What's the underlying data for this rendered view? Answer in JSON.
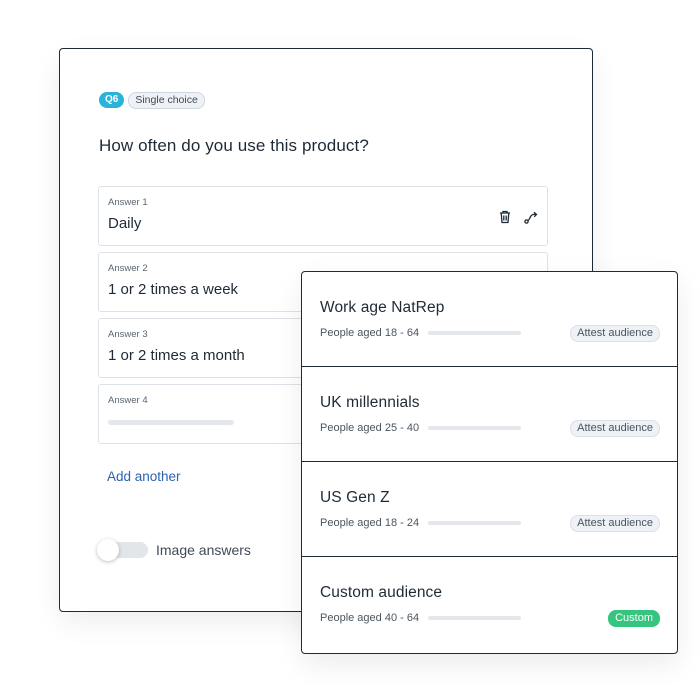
{
  "question": {
    "number_tag": "Q6",
    "type_tag": "Single choice",
    "title": "How often do you use this product?",
    "answers": [
      {
        "label": "Answer 1",
        "value": "Daily"
      },
      {
        "label": "Answer 2",
        "value": "1 or 2 times a week"
      },
      {
        "label": "Answer 3",
        "value": "1 or 2 times a month"
      },
      {
        "label": "Answer 4",
        "value": ""
      }
    ],
    "add_another": "Add another",
    "image_answers_label": "Image answers",
    "icons": {
      "delete": "trash-icon",
      "route": "route-icon"
    }
  },
  "audiences": [
    {
      "name": "Work age NatRep",
      "subtitle": "People aged 18 - 64",
      "badge": "Attest audience"
    },
    {
      "name": "UK millennials",
      "subtitle": "People aged 25 - 40",
      "badge": "Attest audience"
    },
    {
      "name": "US Gen Z",
      "subtitle": "People aged 18 - 24",
      "badge": "Attest audience"
    },
    {
      "name": "Custom audience",
      "subtitle": "People aged 40 - 64",
      "badge": "Custom"
    }
  ],
  "colors": {
    "tag_q": "#2ab3d9",
    "link": "#2b63b0",
    "custom_badge": "#35c57e",
    "border": "#1f2a37"
  }
}
